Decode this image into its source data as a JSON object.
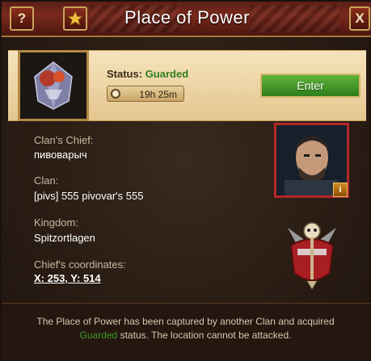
{
  "window": {
    "title": "Place of Power"
  },
  "titlebar": {
    "help_label": "?",
    "close_label": "X",
    "help_icon": "question-icon",
    "fav_icon": "star-icon"
  },
  "header": {
    "status_label": "Status:",
    "status_value": "Guarded",
    "timer": "19h 25m",
    "enter_label": "Enter",
    "status_color": "#2f7d1c"
  },
  "info": {
    "chief_label": "Clan's Chief:",
    "chief_value": "пивоварыч",
    "clan_label": "Clan:",
    "clan_value": "[pivs] 555 pivovar's 555",
    "kingdom_label": "Kingdom:",
    "kingdom_value": "Spitzortlagen",
    "coords_label": "Chief's coordinates:",
    "coords_value": "X: 253, Y: 514",
    "info_badge": "i"
  },
  "footer": {
    "text_part1": "The Place of Power has been captured by another Clan and acquired",
    "text_highlight": "Guarded",
    "text_part2": "status. The location cannot be attacked."
  }
}
